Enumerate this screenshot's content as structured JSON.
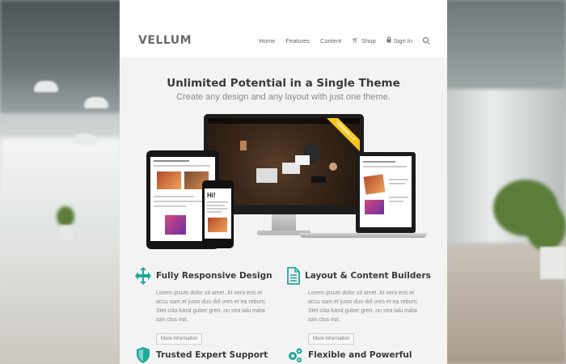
{
  "header": {
    "logo": "VELLUM",
    "nav": [
      {
        "label": "Home"
      },
      {
        "label": "Features"
      },
      {
        "label": "Content"
      },
      {
        "label": "Shop",
        "icon": "cart-icon"
      },
      {
        "label": "Sign In",
        "icon": "lock-icon"
      }
    ],
    "search_icon": "search-icon"
  },
  "hero": {
    "title": "Unlimited Potential in a Single Theme",
    "subtitle": "Create any design and any layout with just one theme."
  },
  "devices": {
    "ribbon": "VERSION 1.0",
    "phone_greeting": "Hi!"
  },
  "features": [
    {
      "icon": "arrows-move-icon",
      "title": "Fully Responsive Design",
      "text": "Lorem ipsum dolor sit amet. At vero eos et accu sam et justo duo dol ores et ea rebum. Stet clita kasd guber gren. no sea taki mata san ctus est.",
      "button": "More information"
    },
    {
      "icon": "document-icon",
      "title": "Layout & Content Builders",
      "text": "Lorem ipsum dolor sit amet. At vero eos et accu sam et justo duo dol ores et ea rebum. Stet clita kasd guber gren. no sea taki mata san ctus est.",
      "button": "More information"
    },
    {
      "icon": "shield-icon",
      "title": "Trusted Expert Support"
    },
    {
      "icon": "gears-icon",
      "title": "Flexible and Powerful"
    }
  ],
  "colors": {
    "accent": "#1fa99c",
    "ribbon": "#f5c518"
  }
}
